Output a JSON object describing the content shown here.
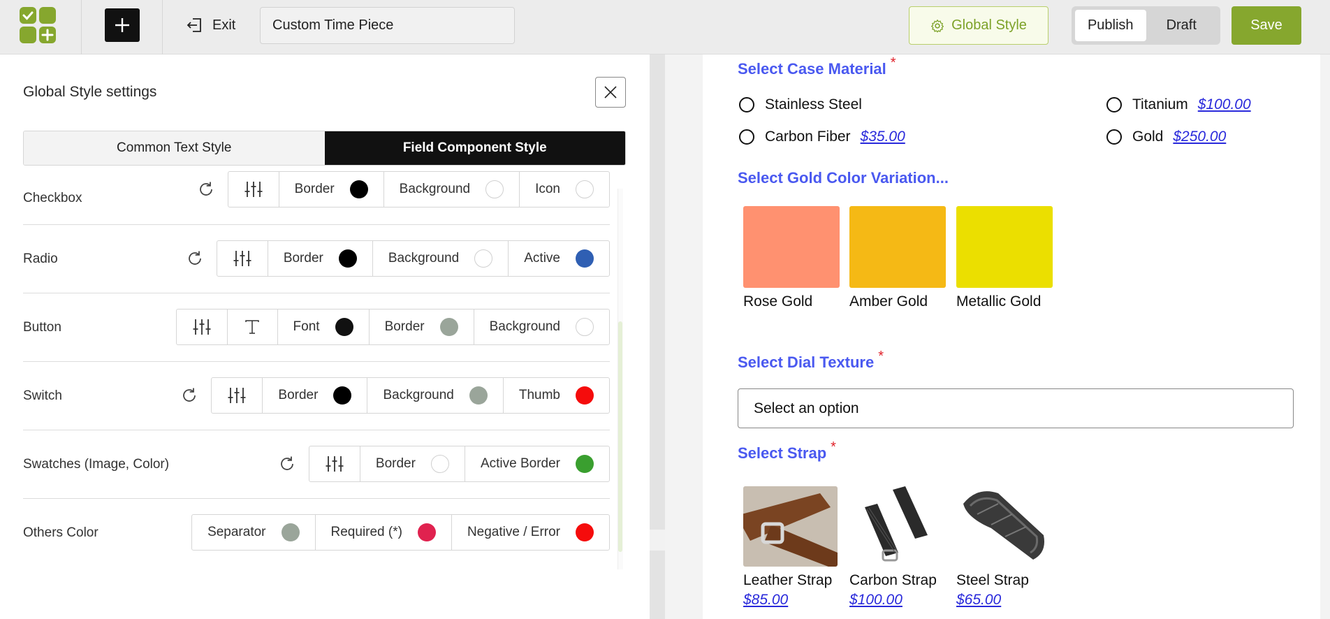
{
  "header": {
    "exit_label": "Exit",
    "title_value": "Custom Time Piece",
    "global_style_label": "Global Style",
    "publish_label": "Publish",
    "draft_label": "Draft",
    "save_label": "Save",
    "accent_color": "#86a72e"
  },
  "settings": {
    "title": "Global Style settings",
    "tabs": [
      {
        "label": "Common Text Style",
        "active": false
      },
      {
        "label": "Field Component Style",
        "active": true
      }
    ],
    "rows": [
      {
        "label": "Checkbox",
        "controls": [
          {
            "label": "Border",
            "color": "#000000"
          },
          {
            "label": "Background",
            "color": "#ffffff"
          },
          {
            "label": "Icon",
            "color": "#ffffff"
          }
        ]
      },
      {
        "label": "Radio",
        "controls": [
          {
            "label": "Border",
            "color": "#000000"
          },
          {
            "label": "Background",
            "color": "#ffffff"
          },
          {
            "label": "Active",
            "color": "#2f5fb3"
          }
        ]
      },
      {
        "label": "Button",
        "controls": [
          {
            "label": "Font",
            "color": "#111111"
          },
          {
            "label": "Border",
            "color": "#9aa59a"
          },
          {
            "label": "Background",
            "color": "#ffffff"
          }
        ]
      },
      {
        "label": "Switch",
        "controls": [
          {
            "label": "Border",
            "color": "#000000"
          },
          {
            "label": "Background",
            "color": "#9aa59a"
          },
          {
            "label": "Thumb",
            "color": "#f50c0c"
          }
        ]
      },
      {
        "label": "Swatches (Image, Color)",
        "controls": [
          {
            "label": "Border",
            "color": "#ffffff"
          },
          {
            "label": "Active Border",
            "color": "#3a9f2f"
          }
        ]
      },
      {
        "label": "Others Color",
        "controls": [
          {
            "label": "Separator",
            "color": "#9aa59a"
          },
          {
            "label": "Required (*)",
            "color": "#e0224f"
          },
          {
            "label": "Negative / Error",
            "color": "#f50c0c"
          }
        ]
      }
    ]
  },
  "preview": {
    "case_material": {
      "label": "Select Case Material",
      "required_mark": "*",
      "options": [
        {
          "label": "Stainless Steel",
          "price": ""
        },
        {
          "label": "Titanium",
          "price": "$100.00"
        },
        {
          "label": "Carbon Fiber",
          "price": "$35.00"
        },
        {
          "label": "Gold",
          "price": "$250.00"
        }
      ]
    },
    "gold_color": {
      "label": "Select Gold Color Variation...",
      "options": [
        {
          "label": "Rose Gold",
          "color": "#ff9170"
        },
        {
          "label": "Amber Gold",
          "color": "#f5b915"
        },
        {
          "label": "Metallic Gold",
          "color": "#ebdf00"
        }
      ]
    },
    "dial_texture": {
      "label": "Select Dial Texture",
      "required_mark": "*",
      "placeholder": "Select an option"
    },
    "strap": {
      "label": "Select Strap",
      "required_mark": "*",
      "options": [
        {
          "label": "Leather Strap",
          "price": "$85.00"
        },
        {
          "label": "Carbon Strap",
          "price": "$100.00"
        },
        {
          "label": "Steel Strap",
          "price": "$65.00"
        }
      ]
    }
  }
}
